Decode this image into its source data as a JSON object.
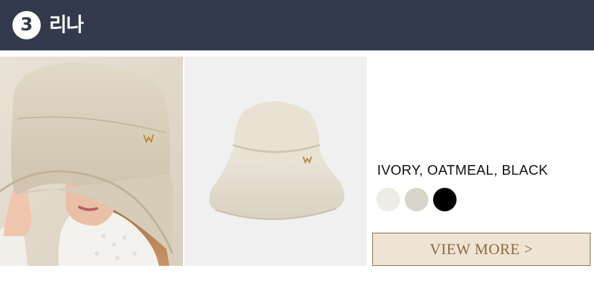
{
  "header": {
    "badge_number": "3",
    "title": "리나",
    "background_color": "#323a4c"
  },
  "images": {
    "model_photo_icon": "woman-wearing-bucket-hat-photo",
    "product_photo_icon": "linen-bucket-hat-product-photo"
  },
  "product": {
    "colors_text": "IVORY, OATMEAL, BLACK",
    "swatches": [
      {
        "name": "ivory",
        "color": "#efebe6"
      },
      {
        "name": "oatmeal",
        "color": "#d8d4ca"
      },
      {
        "name": "black",
        "color": "#000000"
      }
    ]
  },
  "cta": {
    "label": "VIEW MORE >",
    "background_color": "#efe4d3",
    "text_color": "#8a6a45"
  }
}
